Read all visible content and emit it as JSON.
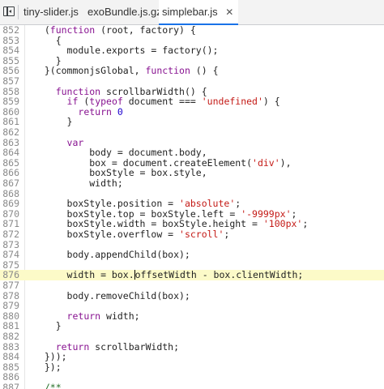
{
  "tabs": [
    {
      "label": "tiny-slider.js",
      "active": false
    },
    {
      "label": "exoBundle.js.gz",
      "active": false
    },
    {
      "label": "simplebar.js",
      "active": true
    }
  ],
  "tab_close_glyph": "✕",
  "colors": {
    "keyword": "#881391",
    "string": "#c41a16",
    "number": "#1c00cf",
    "comment": "#236e25",
    "highlight_line": "#fcfac8",
    "active_tab_underline": "#1a73e8"
  },
  "editor": {
    "highlighted_line": "876",
    "lines": [
      {
        "num": "852",
        "tokens": [
          [
            "plain",
            "  ("
          ],
          [
            "kw",
            "function"
          ],
          [
            "plain",
            " (root, factory) {"
          ]
        ]
      },
      {
        "num": "853",
        "tokens": [
          [
            "plain",
            "    {"
          ]
        ]
      },
      {
        "num": "854",
        "tokens": [
          [
            "plain",
            "      module.exports = factory();"
          ]
        ]
      },
      {
        "num": "855",
        "tokens": [
          [
            "plain",
            "    }"
          ]
        ]
      },
      {
        "num": "856",
        "tokens": [
          [
            "plain",
            "  }(commonjsGlobal, "
          ],
          [
            "kw",
            "function"
          ],
          [
            "plain",
            " () {"
          ]
        ]
      },
      {
        "num": "857",
        "tokens": []
      },
      {
        "num": "858",
        "tokens": [
          [
            "plain",
            "    "
          ],
          [
            "kw",
            "function"
          ],
          [
            "plain",
            " scrollbarWidth() {"
          ]
        ]
      },
      {
        "num": "859",
        "tokens": [
          [
            "plain",
            "      "
          ],
          [
            "kw",
            "if"
          ],
          [
            "plain",
            " ("
          ],
          [
            "kw",
            "typeof"
          ],
          [
            "plain",
            " document === "
          ],
          [
            "str",
            "'undefined'"
          ],
          [
            "plain",
            ") {"
          ]
        ]
      },
      {
        "num": "860",
        "tokens": [
          [
            "plain",
            "        "
          ],
          [
            "kw",
            "return"
          ],
          [
            "plain",
            " "
          ],
          [
            "num",
            "0"
          ]
        ]
      },
      {
        "num": "861",
        "tokens": [
          [
            "plain",
            "      }"
          ]
        ]
      },
      {
        "num": "862",
        "tokens": []
      },
      {
        "num": "863",
        "tokens": [
          [
            "plain",
            "      "
          ],
          [
            "kw",
            "var"
          ]
        ]
      },
      {
        "num": "864",
        "tokens": [
          [
            "plain",
            "          body = document.body,"
          ]
        ]
      },
      {
        "num": "865",
        "tokens": [
          [
            "plain",
            "          box = document.createElement("
          ],
          [
            "str",
            "'div'"
          ],
          [
            "plain",
            "),"
          ]
        ]
      },
      {
        "num": "866",
        "tokens": [
          [
            "plain",
            "          boxStyle = box.style,"
          ]
        ]
      },
      {
        "num": "867",
        "tokens": [
          [
            "plain",
            "          width;"
          ]
        ]
      },
      {
        "num": "868",
        "tokens": []
      },
      {
        "num": "869",
        "tokens": [
          [
            "plain",
            "      boxStyle.position = "
          ],
          [
            "str",
            "'absolute'"
          ],
          [
            "plain",
            ";"
          ]
        ]
      },
      {
        "num": "870",
        "tokens": [
          [
            "plain",
            "      boxStyle.top = boxStyle.left = "
          ],
          [
            "str",
            "'-9999px'"
          ],
          [
            "plain",
            ";"
          ]
        ]
      },
      {
        "num": "871",
        "tokens": [
          [
            "plain",
            "      boxStyle.width = boxStyle.height = "
          ],
          [
            "str",
            "'100px'"
          ],
          [
            "plain",
            ";"
          ]
        ]
      },
      {
        "num": "872",
        "tokens": [
          [
            "plain",
            "      boxStyle.overflow = "
          ],
          [
            "str",
            "'scroll'"
          ],
          [
            "plain",
            ";"
          ]
        ]
      },
      {
        "num": "873",
        "tokens": []
      },
      {
        "num": "874",
        "tokens": [
          [
            "plain",
            "      body.appendChild(box);"
          ]
        ]
      },
      {
        "num": "875",
        "tokens": []
      },
      {
        "num": "876",
        "tokens": [
          [
            "plain",
            "      width = box."
          ],
          [
            "cursor",
            ""
          ],
          [
            "plain",
            "offsetWidth - box.clientWidth;"
          ]
        ]
      },
      {
        "num": "877",
        "tokens": []
      },
      {
        "num": "878",
        "tokens": [
          [
            "plain",
            "      body.removeChild(box);"
          ]
        ]
      },
      {
        "num": "879",
        "tokens": []
      },
      {
        "num": "880",
        "tokens": [
          [
            "plain",
            "      "
          ],
          [
            "kw",
            "return"
          ],
          [
            "plain",
            " width;"
          ]
        ]
      },
      {
        "num": "881",
        "tokens": [
          [
            "plain",
            "    }"
          ]
        ]
      },
      {
        "num": "882",
        "tokens": []
      },
      {
        "num": "883",
        "tokens": [
          [
            "plain",
            "    "
          ],
          [
            "kw",
            "return"
          ],
          [
            "plain",
            " scrollbarWidth;"
          ]
        ]
      },
      {
        "num": "884",
        "tokens": [
          [
            "plain",
            "  }));"
          ]
        ]
      },
      {
        "num": "885",
        "tokens": [
          [
            "plain",
            "  });"
          ]
        ]
      },
      {
        "num": "886",
        "tokens": []
      },
      {
        "num": "887",
        "tokens": [
          [
            "plain",
            "  "
          ],
          [
            "comment",
            "/**"
          ]
        ]
      }
    ]
  }
}
